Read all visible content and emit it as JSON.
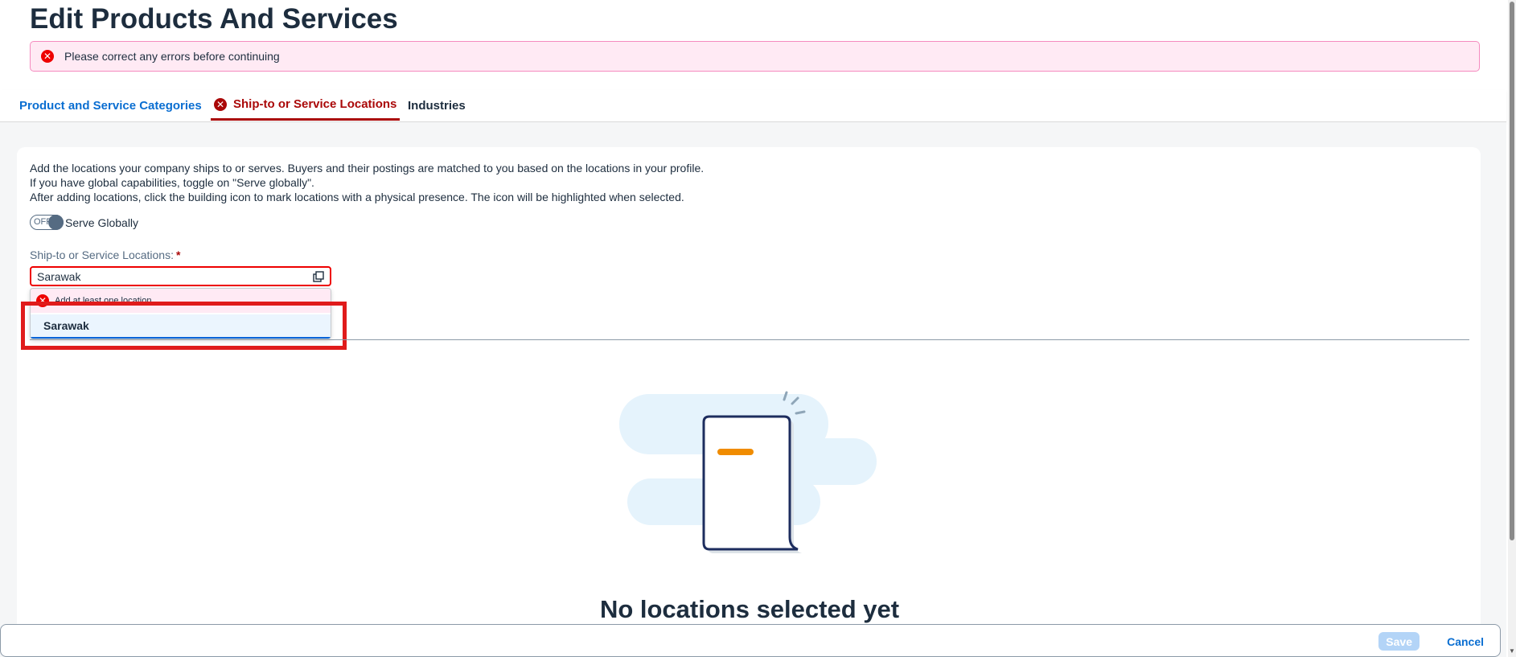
{
  "page": {
    "title": "Edit Products And Services",
    "error_banner": "Please correct any errors before continuing"
  },
  "tabs": [
    {
      "label": "Product and Service Categories"
    },
    {
      "label": "Ship-to or Service Locations",
      "state": "error",
      "selected": true
    },
    {
      "label": "Industries"
    }
  ],
  "description": [
    "Add the locations your company ships to or serves. Buyers and their postings are matched to you based on the locations in your profile.",
    "If you have global capabilities, toggle on \"Serve globally\".",
    "After adding locations, click the building icon to mark locations with a physical presence. The icon will be highlighted when selected."
  ],
  "serve_globally": {
    "toggle_text": "OFF",
    "label": "Serve Globally",
    "on": false
  },
  "locations_field": {
    "label": "Ship-to or Service Locations:",
    "required_mark": "*",
    "value": "Sarawak",
    "error": "Add at least one location",
    "suggestions": [
      "Sarawak"
    ]
  },
  "empty_state": {
    "title": "No locations selected yet"
  },
  "footer": {
    "save": "Save",
    "cancel": "Cancel"
  },
  "colors": {
    "accent": "#0a6ed1",
    "error": "#aa0808",
    "highlight": "#e01b1b"
  }
}
